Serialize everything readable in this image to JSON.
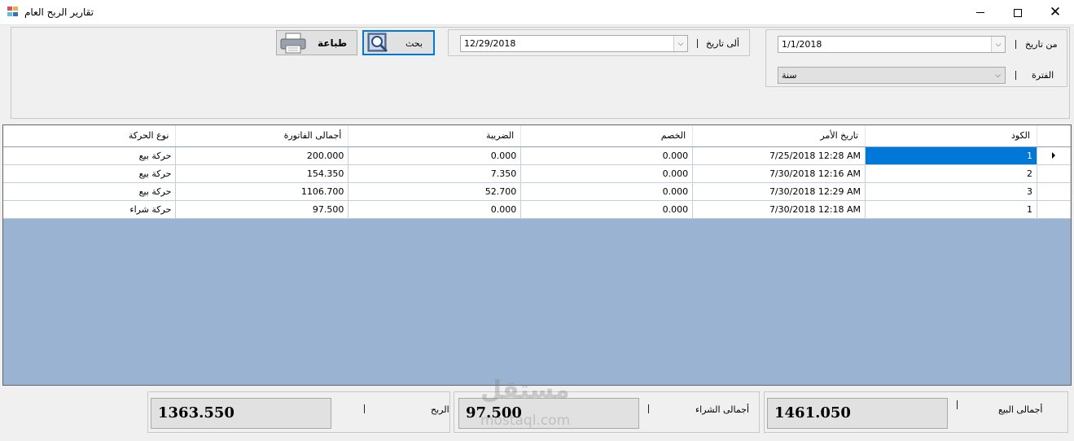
{
  "window": {
    "title": "تقارير الربح العام",
    "controls": {
      "minimize": "—",
      "maximize": "☐",
      "close": "✕"
    }
  },
  "filters": {
    "from_date_label": "من تاريخ",
    "from_date_value": "1/1/2018",
    "to_date_label": "ألى تاريخ",
    "to_date_value": "12/29/2018",
    "period_label": "الفترة",
    "period_value": "سنة",
    "separator": "|"
  },
  "buttons": {
    "search_label": "بحث",
    "print_label": "طباعة"
  },
  "grid": {
    "columns": {
      "code": "الكود",
      "order_date": "تاريخ الأمر",
      "discount": "الخصم",
      "tax": "الضريبة",
      "invoice_total": "أجمالى الفاتورة",
      "movement_type": "نوع الحركة"
    },
    "rows": [
      {
        "code": "1",
        "order_date": "7/25/2018 12:28 AM",
        "discount": "0.000",
        "tax": "0.000",
        "invoice_total": "200.000",
        "movement_type": "حركة بيع"
      },
      {
        "code": "2",
        "order_date": "7/30/2018 12:16 AM",
        "discount": "0.000",
        "tax": "7.350",
        "invoice_total": "154.350",
        "movement_type": "حركة بيع"
      },
      {
        "code": "3",
        "order_date": "7/30/2018 12:29 AM",
        "discount": "0.000",
        "tax": "52.700",
        "invoice_total": "1106.700",
        "movement_type": "حركة بيع"
      },
      {
        "code": "1",
        "order_date": "7/30/2018 12:18 AM",
        "discount": "0.000",
        "tax": "0.000",
        "invoice_total": "97.500",
        "movement_type": "حركة شراء"
      }
    ]
  },
  "totals": {
    "sales_label": "أجمالى البيع",
    "sales_value": "1461.050",
    "purchase_label": "أجمالى الشراء",
    "purchase_value": "97.500",
    "profit_label": "الربح",
    "profit_value": "1363.550"
  },
  "watermark": {
    "big": "مستقل",
    "small": "mostaql.com"
  },
  "colors": {
    "selection": "#0078d7",
    "grid_background": "#9bb3d2",
    "window_background": "#f0f0f0"
  }
}
